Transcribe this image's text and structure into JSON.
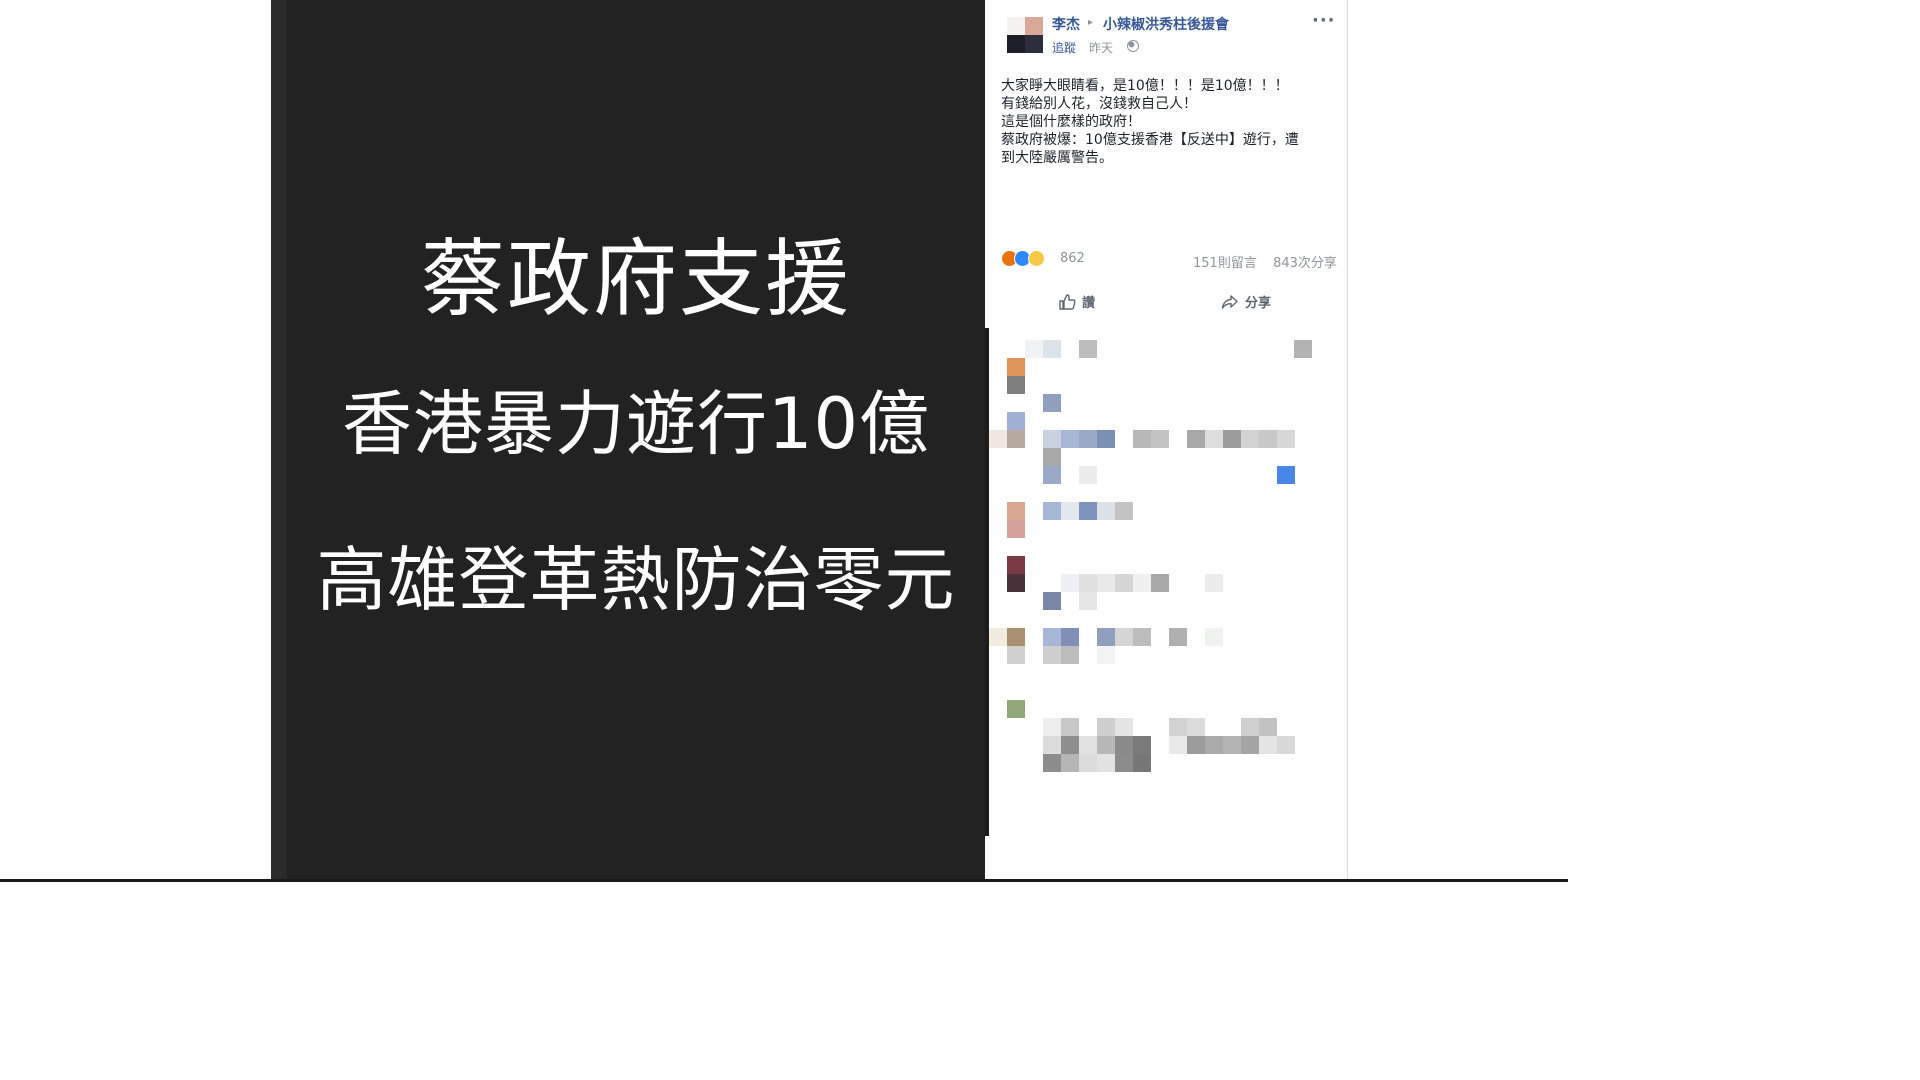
{
  "image_post": {
    "line1": "蔡政府支援",
    "line2": "香港暴力遊行10億",
    "line3": "高雄登革熱防治零元"
  },
  "post": {
    "author": "李杰",
    "group": "小辣椒洪秀柱後援會",
    "follow_label": "追蹤",
    "time": "昨天",
    "more_label": "···",
    "body": [
      "大家睜大眼睛看，是10億！！！是10億！！！",
      "有錢給別人花，沒錢救自己人！",
      "這是個什麼樣的政府！",
      "蔡政府被爆：10億支援香港【反送中】遊行，遭",
      "到大陸嚴厲警告。"
    ],
    "reaction_count": "862",
    "comments_count": "151則留言",
    "shares_count": "843次分享",
    "like_label": "讚",
    "share_label": "分享"
  },
  "colors": {
    "link": "#365899",
    "image_bg": "#222222",
    "angry": "#e9710f",
    "like": "#2d88ff",
    "wow": "#f7c844"
  },
  "icons": [
    "globe-icon",
    "more-icon",
    "like-icon",
    "share-icon",
    "angry-reaction-icon",
    "like-reaction-icon",
    "wow-reaction-icon"
  ]
}
